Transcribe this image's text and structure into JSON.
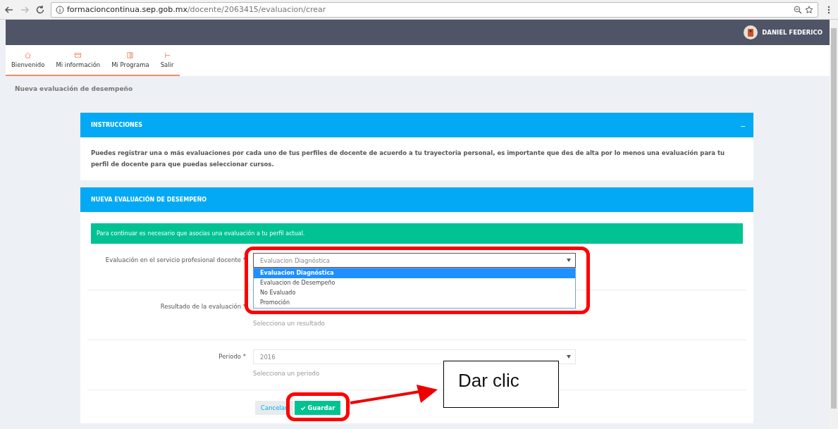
{
  "browser": {
    "url_host": "formacioncontinua.sep.gob.mx",
    "url_path": "/docente/2063415/evaluacion/crear"
  },
  "header": {
    "user_name": "DANIEL FEDERICO"
  },
  "nav": [
    {
      "label": "Bienvenido"
    },
    {
      "label": "Mi información"
    },
    {
      "label": "Mi Programa"
    },
    {
      "label": "Salir"
    }
  ],
  "breadcrumb": "Nueva evaluación de desempeño",
  "instructions": {
    "title": "INSTRUCCIONES",
    "collapse": "–",
    "text": "Puedes registrar una o más evaluaciones por cada uno de tus perfiles de docente de acuerdo a tu trayectoria personal, es importante que des de alta por lo menos una evaluación para tu perfil de docente para que puedas seleccionar cursos."
  },
  "form": {
    "title": "NUEVA EVALUACIÓN DE DESEMPEÑO",
    "alert": "Para continuar es necesario que asocias una evaluación a tu perfil actual.",
    "fields": [
      {
        "label": "Evaluación en el servicio profesional docente *",
        "value": "Evaluacion Diagnóstica",
        "open": true,
        "options": [
          {
            "label": "Evaluacion Diagnóstica",
            "selected": true
          },
          {
            "label": "Evaluacion de Desempeño",
            "selected": false
          },
          {
            "label": "No Evaluado",
            "selected": false
          },
          {
            "label": "Promoción",
            "selected": false
          }
        ]
      },
      {
        "label": "Resultado de la evaluación *",
        "open": false,
        "help": "Selecciona un resultado"
      },
      {
        "label": "Periodo *",
        "value": "2016",
        "open": false,
        "help": "Selecciona un periodo"
      }
    ],
    "cancel": "Cancelar",
    "save": "Guardar"
  },
  "annotation": {
    "callout": "Dar clic"
  }
}
